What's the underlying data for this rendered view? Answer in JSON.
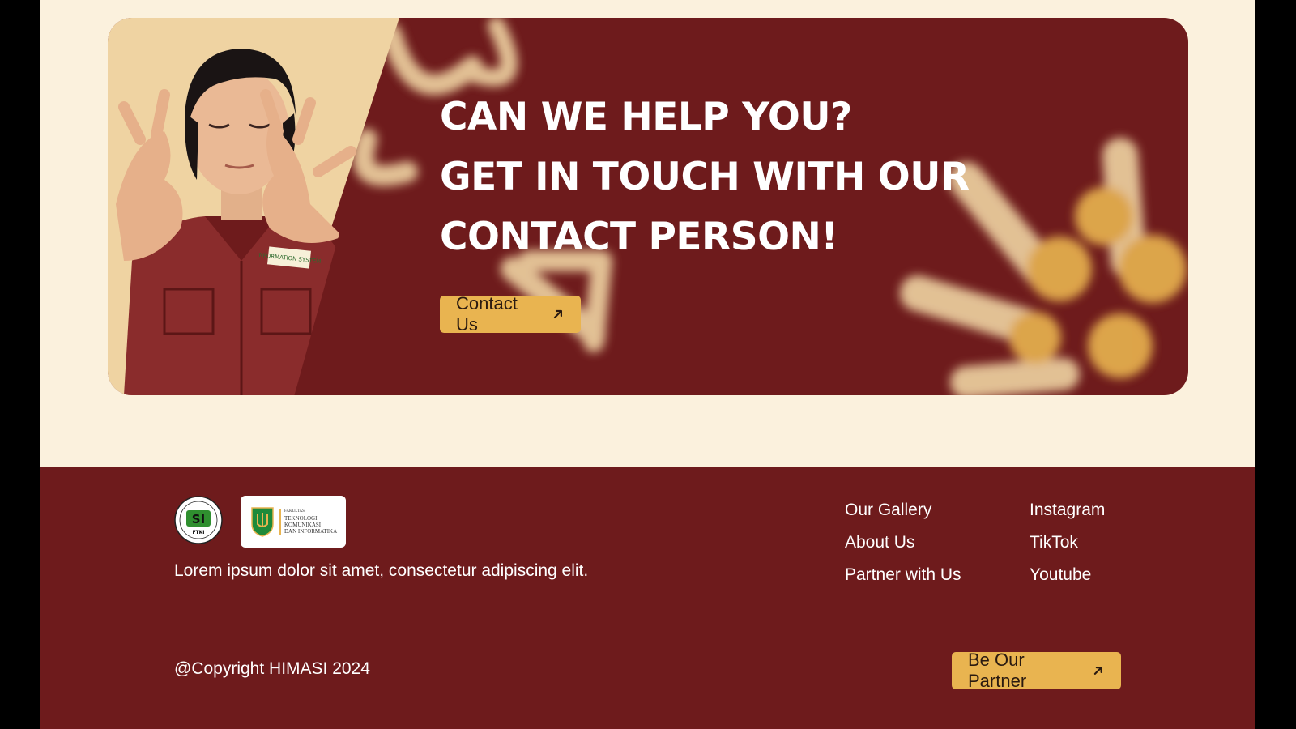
{
  "cta": {
    "heading_lines": [
      "CAN WE HELP YOU?",
      "GET IN TOUCH WITH OUR",
      "CONTACT PERSON!"
    ],
    "button_label": "Contact Us",
    "shirt_badge": "INFORMATION SYSTEM"
  },
  "footer": {
    "logo_si_text": "SI",
    "logo_si_subtext": "FTKI",
    "logo_fakultas_lines": [
      "FAKULTAS",
      "TEKNOLOGI",
      "KOMUNIKASI",
      "DAN INFORMATIKA"
    ],
    "description": "Lorem ipsum dolor sit amet, consectetur adipiscing elit.",
    "links_col1": [
      "Our Gallery",
      "About Us",
      "Partner with Us"
    ],
    "links_col2": [
      "Instagram",
      "TikTok",
      "Youtube"
    ],
    "copyright": "@Copyright HIMASI 2024",
    "partner_button_label": "Be Our Partner"
  },
  "colors": {
    "maroon": "#6e1b1c",
    "cream": "#fbf1dd",
    "gold": "#e9b450",
    "sand": "#efd3a2"
  }
}
